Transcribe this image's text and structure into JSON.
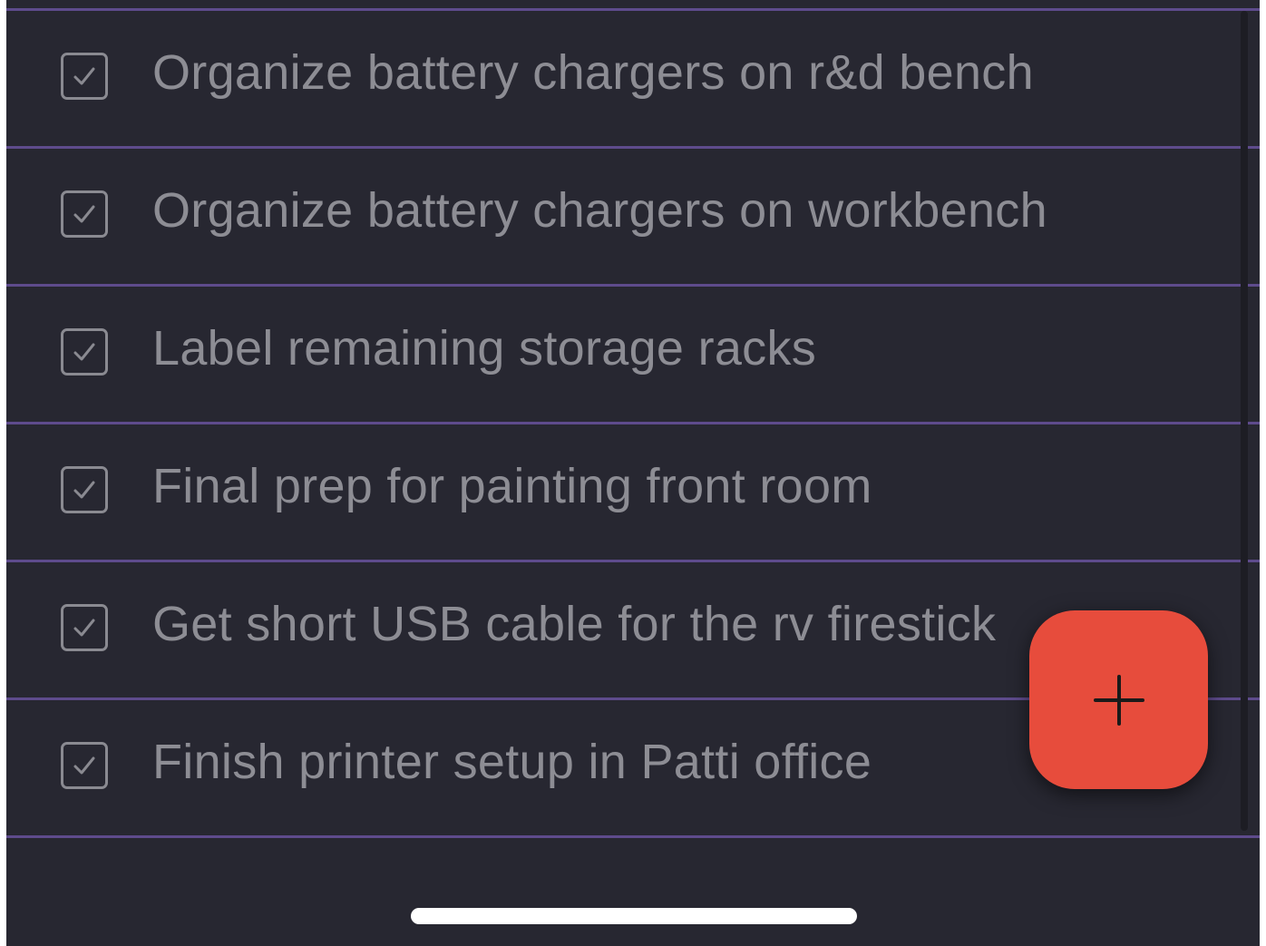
{
  "tasks": [
    {
      "label": "Organize battery chargers on r&d bench",
      "checked": true
    },
    {
      "label": "Organize battery chargers on workbench",
      "checked": true
    },
    {
      "label": "Label remaining storage racks",
      "checked": true
    },
    {
      "label": "Final prep for painting front room",
      "checked": true
    },
    {
      "label": "Get short USB cable for the rv firestick",
      "checked": true
    },
    {
      "label": "Finish printer setup in Patti office",
      "checked": true
    }
  ],
  "fab": {
    "icon": "plus-icon",
    "color": "#e74c3c"
  },
  "theme": {
    "background": "#272731",
    "divider": "#5e4b8c",
    "text": "#8d8d94"
  }
}
